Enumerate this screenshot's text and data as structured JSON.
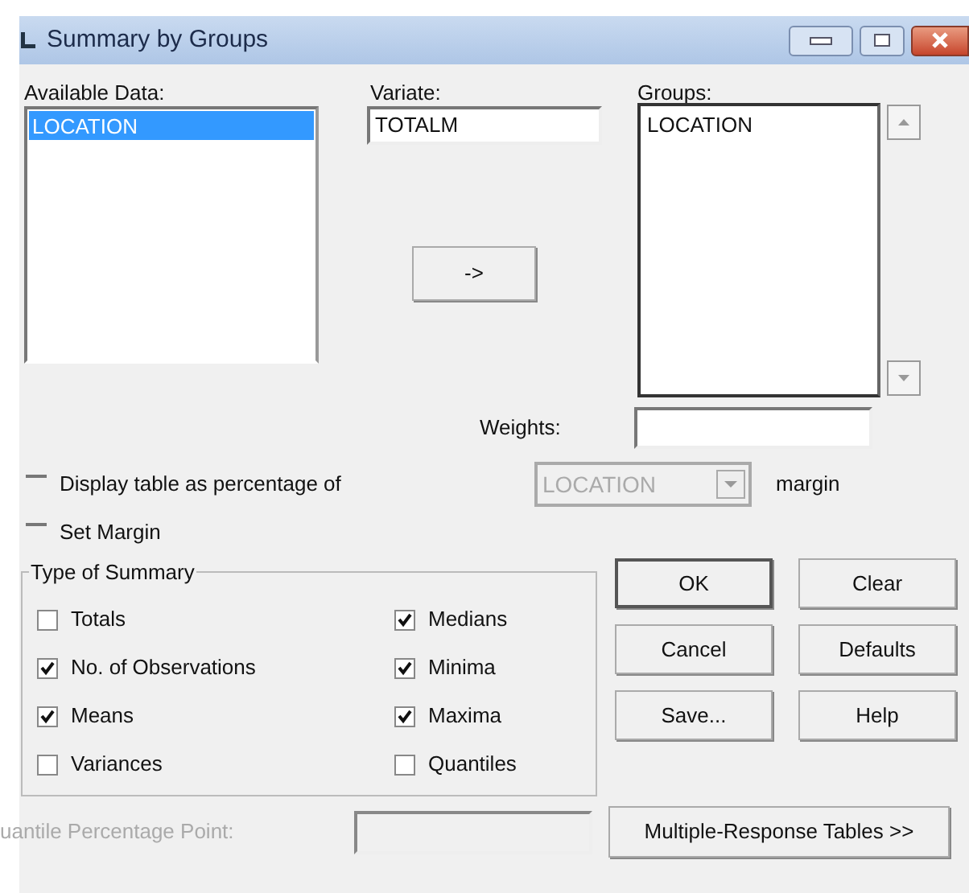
{
  "window": {
    "title": "Summary by Groups"
  },
  "available_data": {
    "label": "Available Data:",
    "items": [
      {
        "text": "LOCATION",
        "selected": true
      }
    ]
  },
  "variate": {
    "label": "Variate:",
    "value": "TOTALM"
  },
  "move_button": {
    "label": "->"
  },
  "groups": {
    "label": "Groups:",
    "items": [
      {
        "text": "LOCATION",
        "selected": false
      }
    ]
  },
  "weights": {
    "label": "Weights:"
  },
  "display_percentage": {
    "label": "Display table as percentage of",
    "checked": false
  },
  "margin_select": {
    "value": "LOCATION",
    "disabled": true,
    "suffix": "margin"
  },
  "set_margin": {
    "label": "Set Margin",
    "checked": false
  },
  "type_of_summary": {
    "title": "Type of Summary",
    "options": [
      {
        "label": "Totals",
        "checked": false
      },
      {
        "label": "Medians",
        "checked": true
      },
      {
        "label": "No. of Observations",
        "checked": true
      },
      {
        "label": "Minima",
        "checked": true
      },
      {
        "label": "Means",
        "checked": true
      },
      {
        "label": "Maxima",
        "checked": true
      },
      {
        "label": "Variances",
        "checked": false
      },
      {
        "label": "Quantiles",
        "checked": false
      }
    ]
  },
  "quantile": {
    "label": "uantile Percentage Point:",
    "disabled": true
  },
  "buttons": [
    {
      "label": "OK",
      "default": true
    },
    {
      "label": "Clear",
      "default": false
    },
    {
      "label": "Cancel",
      "default": false
    },
    {
      "label": "Defaults",
      "default": false
    },
    {
      "label": "Save...",
      "default": false
    },
    {
      "label": "Help",
      "default": false
    }
  ],
  "multiple_response_button": {
    "label": "Multiple-Response Tables >>"
  }
}
